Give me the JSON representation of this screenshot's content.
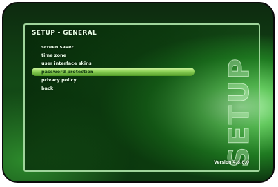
{
  "header": {
    "title": "SETUP - GENERAL"
  },
  "menu": {
    "items": [
      {
        "label": "screen saver"
      },
      {
        "label": "time zone"
      },
      {
        "label": "user interface skins"
      },
      {
        "label": "password protection",
        "selected": true
      },
      {
        "label": "privacy policy"
      },
      {
        "label": "back"
      }
    ]
  },
  "side": {
    "label": "SETUP"
  },
  "footer": {
    "version": "Version 4.8.8.0"
  },
  "colors": {
    "accent": "#90d35a",
    "frame": "#9fd59b",
    "background": "#134a16"
  }
}
